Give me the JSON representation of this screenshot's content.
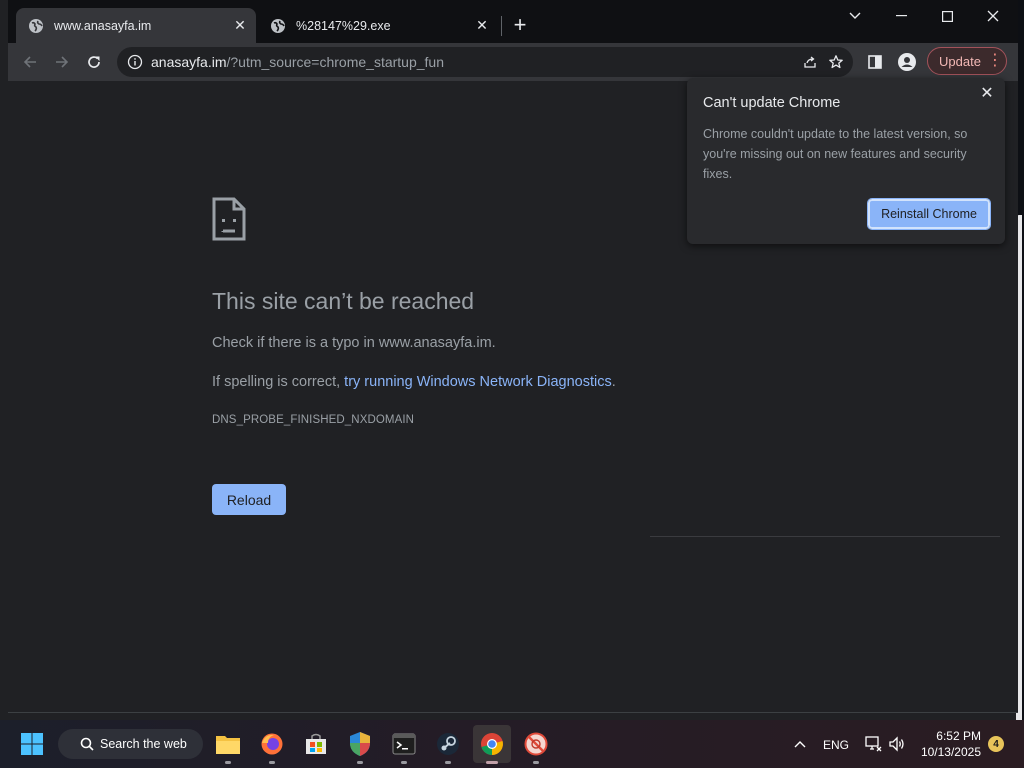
{
  "tabs": [
    {
      "title": "www.anasayfa.im",
      "active": true
    },
    {
      "title": "%28147%29.exe",
      "active": false
    }
  ],
  "omnibox": {
    "host": "anasayfa.im",
    "path": "/?utm_source=chrome_startup_fun"
  },
  "toolbar": {
    "update_label": "Update"
  },
  "error_page": {
    "title": "This site can’t be reached",
    "line1": "Check if there is a typo in www.anasayfa.im.",
    "line2_prefix": "If spelling is correct, ",
    "line2_link": "try running Windows Network Diagnostics",
    "line2_suffix": ".",
    "error_code": "DNS_PROBE_FINISHED_NXDOMAIN",
    "reload_label": "Reload"
  },
  "bubble": {
    "title": "Can't update Chrome",
    "body": "Chrome couldn't update to the latest version, so you're missing out on new features and security fixes.",
    "button_label": "Reinstall Chrome"
  },
  "taskbar": {
    "search_label": "Search the web",
    "language": "ENG",
    "time": "6:52 PM",
    "date": "10/13/2025",
    "notification_count": "4"
  },
  "colors": {
    "accent": "#8ab4f8",
    "page_bg": "#202124",
    "update_border": "#a3525a"
  }
}
